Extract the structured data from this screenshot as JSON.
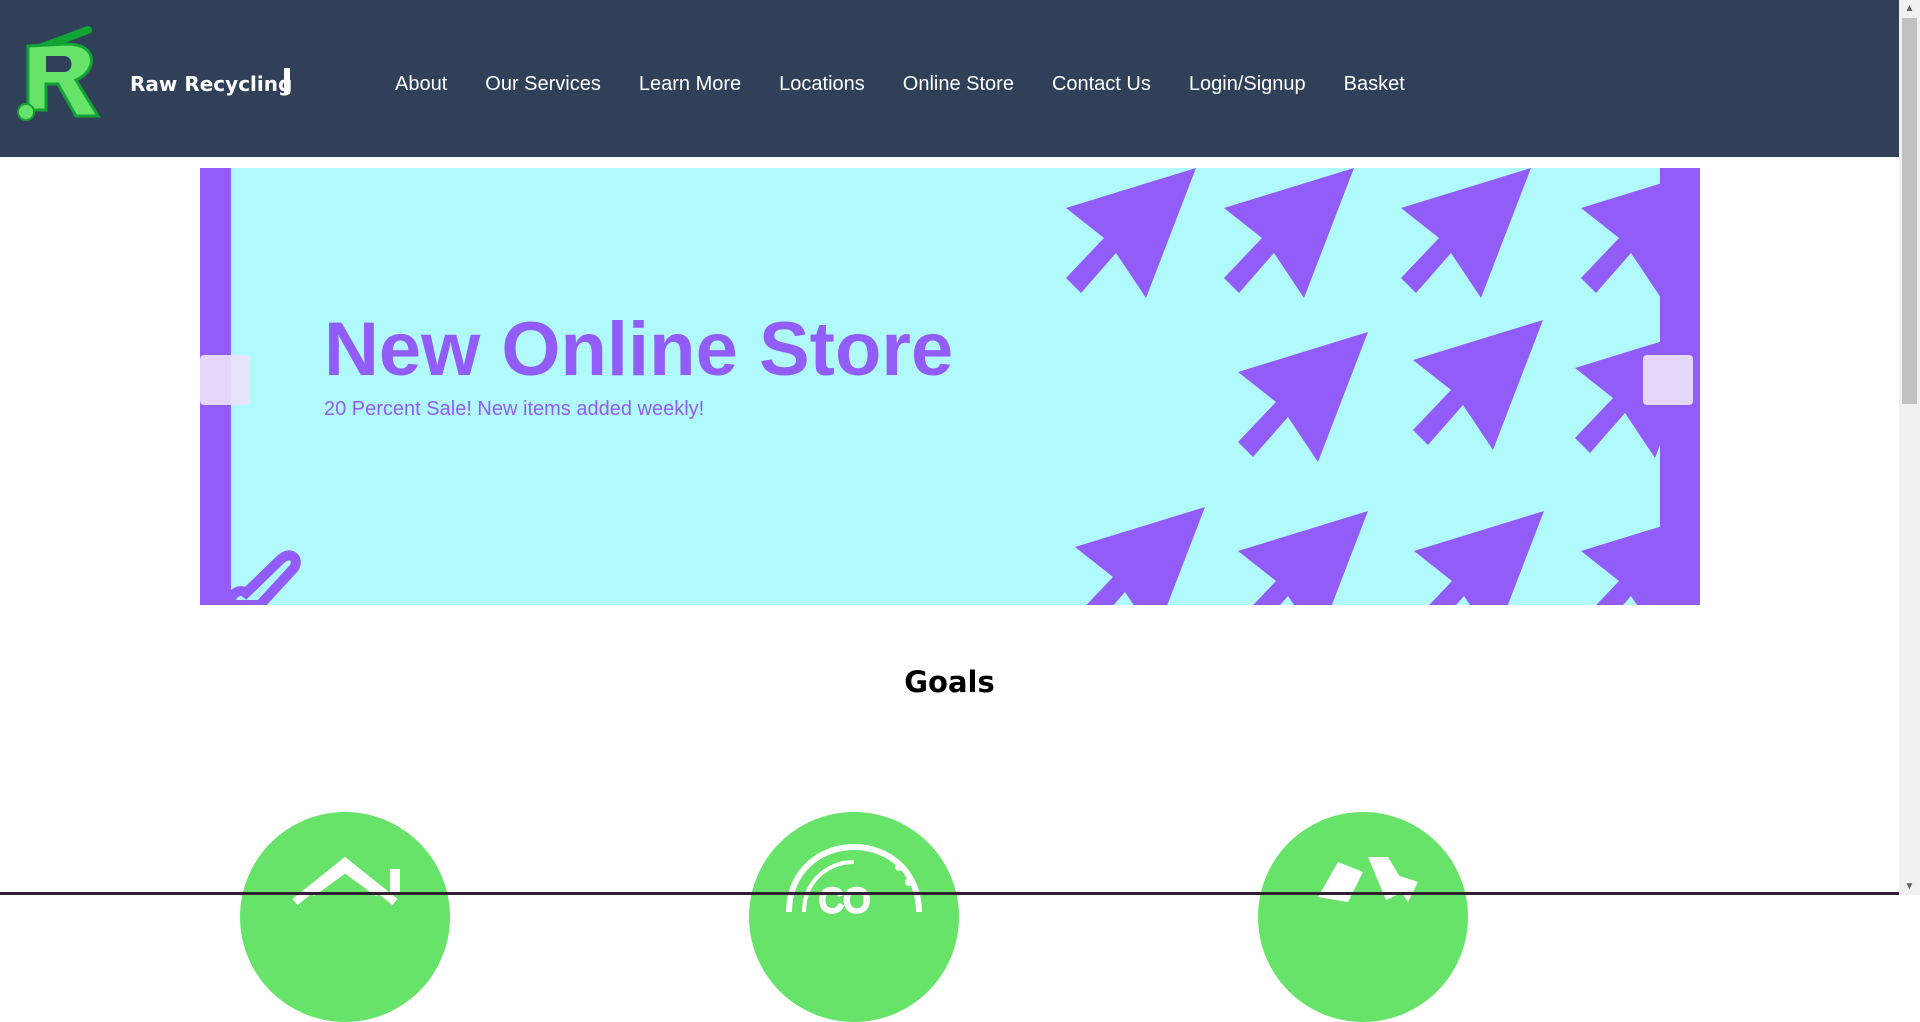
{
  "header": {
    "brand": "Raw Recycling",
    "logo_letter": "R",
    "nav": [
      "About",
      "Our Services",
      "Learn More",
      "Locations",
      "Online Store",
      "Contact Us",
      "Login/Signup",
      "Basket"
    ]
  },
  "slider": {
    "title": "New Online Store",
    "subtitle": "20 Percent Sale! New items added weekly!"
  },
  "goals": {
    "title": "Goals",
    "icons": [
      "home-icon",
      "co2-icon",
      "recycle-icon"
    ]
  },
  "colors": {
    "header_bg": "#2f4058",
    "accent_purple": "#925cf9",
    "slide_bg": "#b1fafb",
    "logo_green": "#67e36a",
    "goal_green": "#67e36a"
  }
}
